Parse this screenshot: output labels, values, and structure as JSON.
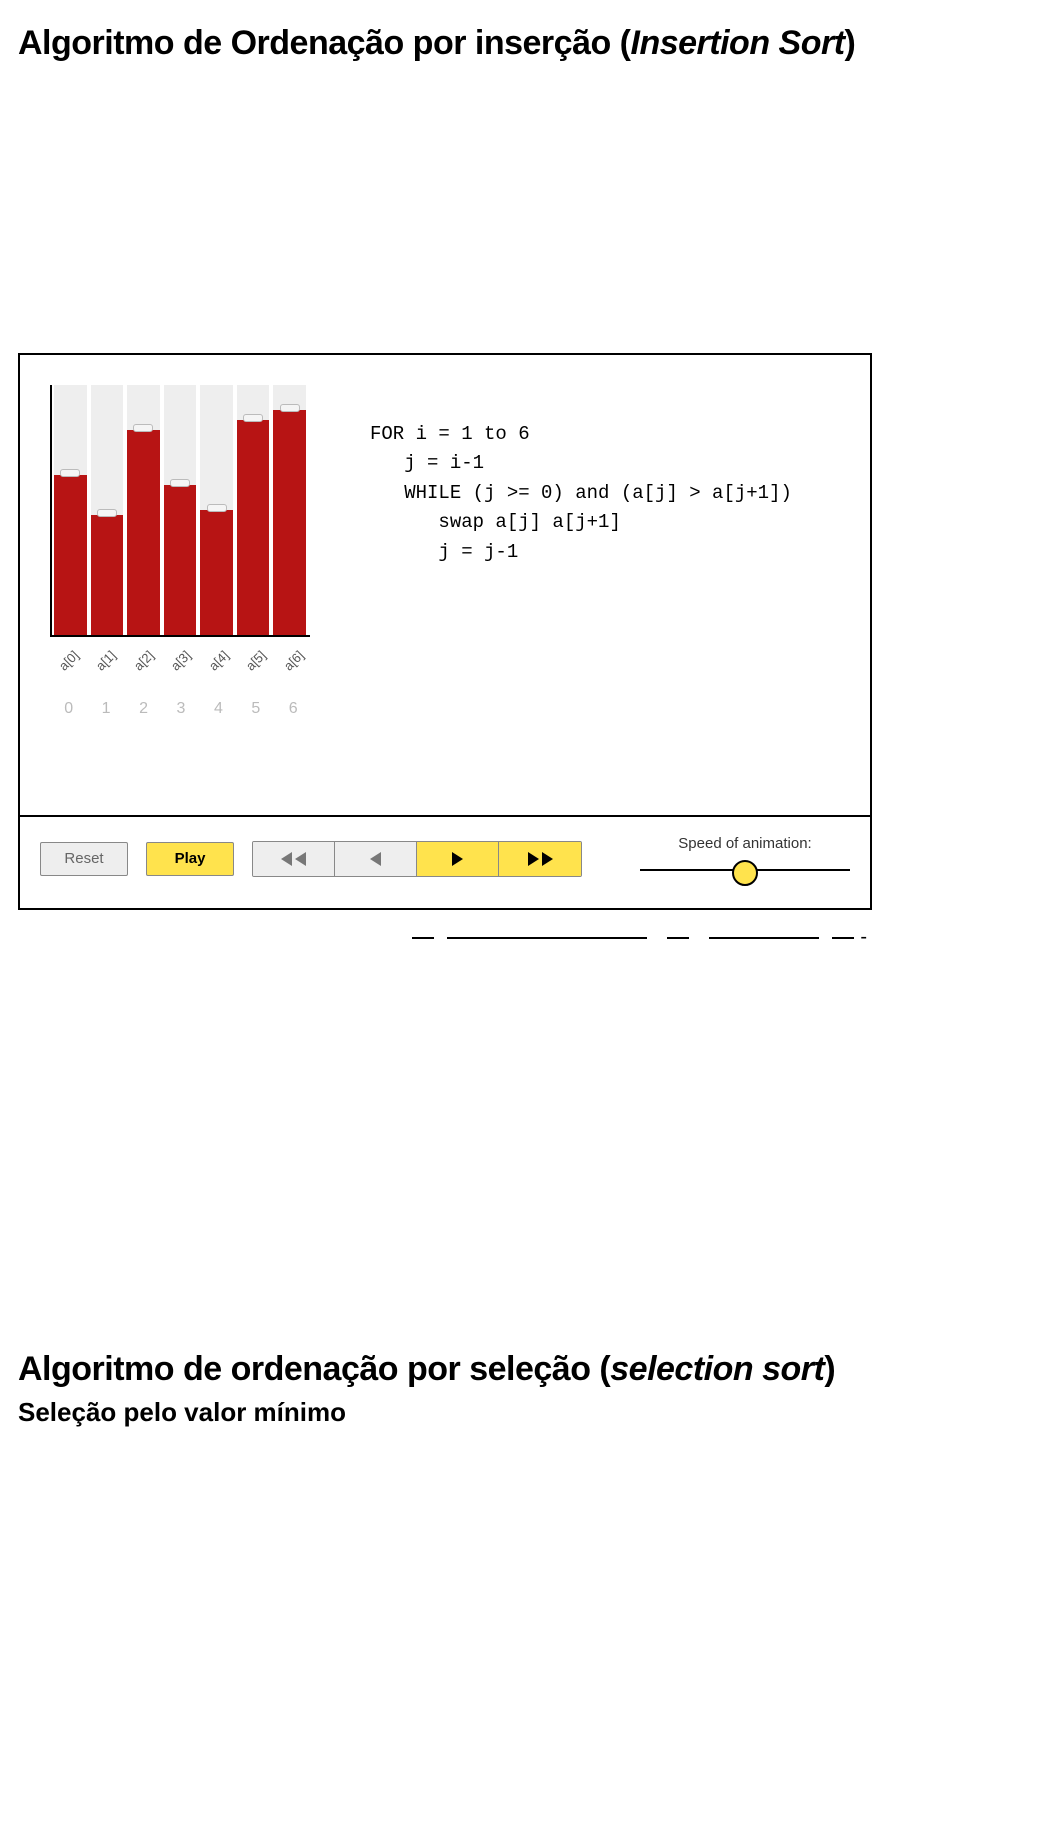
{
  "section1": {
    "title_prefix": "Algoritmo de Ordenação por inserção (",
    "title_italic": "Insertion Sort",
    "title_suffix": ")"
  },
  "chart_data": {
    "type": "bar",
    "categories": [
      "a[0]",
      "a[1]",
      "a[2]",
      "a[3]",
      "a[4]",
      "a[5]",
      "a[6]"
    ],
    "indices": [
      "0",
      "1",
      "2",
      "3",
      "4",
      "5",
      "6"
    ],
    "values": [
      64,
      48,
      82,
      60,
      50,
      86,
      90
    ],
    "ylim": [
      0,
      100
    ],
    "title": "",
    "xlabel": "",
    "ylabel": ""
  },
  "code": {
    "l1": "FOR i = 1 to 6",
    "l2": "   j = i-1",
    "l3": "   WHILE (j >= 0) and (a[j] > a[j+1])",
    "l4": "      swap a[j] a[j+1]",
    "l5": "      j = j-1"
  },
  "controls": {
    "reset": "Reset",
    "play": "Play",
    "speed_label": "Speed of animation:"
  },
  "section2": {
    "title_prefix": "Algoritmo de ordenação por seleção (",
    "title_italic": "selection sort",
    "title_suffix": ")",
    "subtitle": "Seleção pelo valor mínimo"
  }
}
